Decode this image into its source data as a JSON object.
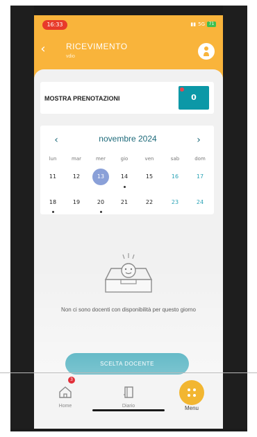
{
  "status_bar": {
    "time": "16:33",
    "signal": "5G",
    "battery": "71"
  },
  "header": {
    "back_icon": "chevron-left-icon",
    "title": "RICEVIMENTO",
    "subtitle": "vdio",
    "avatar_icon": "user-icon"
  },
  "bookings": {
    "label": "MOSTRA PRENOTAZIONI",
    "count": "0"
  },
  "calendar": {
    "month": "novembre 2024",
    "prev_icon": "chevron-left-icon",
    "next_icon": "chevron-right-icon",
    "weekdays": [
      "lun",
      "mar",
      "mer",
      "gio",
      "ven",
      "sab",
      "dom"
    ],
    "weeks": [
      [
        "11",
        "12",
        "13",
        "14",
        "15",
        "16",
        "17"
      ],
      [
        "18",
        "19",
        "20",
        "21",
        "22",
        "23",
        "24"
      ]
    ],
    "selected_day": "13",
    "days_with_events": [
      "14",
      "18",
      "20"
    ]
  },
  "empty_state": {
    "icon": "empty-inbox-icon",
    "message": "Non ci sono docenti con disponibilità per questo giorno"
  },
  "cta": {
    "label": "SCELTA DOCENTE"
  },
  "tabbar": {
    "home": {
      "label": "Home",
      "icon": "home-icon",
      "badge": "3"
    },
    "diary": {
      "label": "Diario",
      "icon": "book-icon"
    },
    "menu": {
      "label": "Menu",
      "icon": "menu-icon"
    }
  },
  "colors": {
    "header": "#f9b43b",
    "accent": "#0c98a7",
    "selected_day": "#8aa0d8",
    "weekend": "#2aa3b6",
    "badge": "#e2303a"
  }
}
